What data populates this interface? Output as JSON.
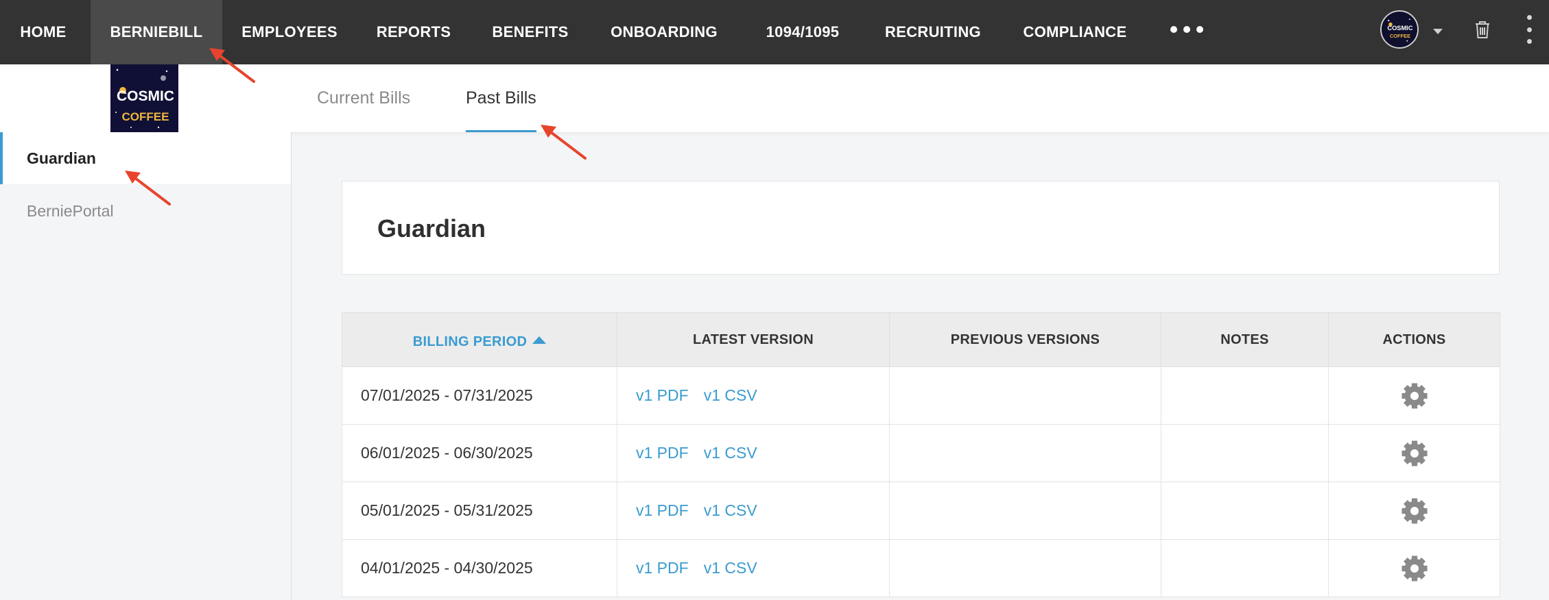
{
  "nav": {
    "items": [
      {
        "label": "HOME",
        "active": false
      },
      {
        "label": "BERNIEBILL",
        "active": true
      },
      {
        "label": "EMPLOYEES",
        "active": false
      },
      {
        "label": "REPORTS",
        "active": false
      },
      {
        "label": "BENEFITS",
        "active": false
      },
      {
        "label": "ONBOARDING",
        "active": false
      },
      {
        "label": "1094/1095",
        "active": false
      },
      {
        "label": "RECRUITING",
        "active": false
      },
      {
        "label": "COMPLIANCE",
        "active": false
      }
    ],
    "more_icon": "more-dots-icon",
    "avatar_text_line1": "COSMIC",
    "avatar_text_line2": "COFFEE",
    "caret_icon": "caret-down-icon",
    "trash_icon": "trash-icon",
    "kebab_icon": "kebab-menu-icon"
  },
  "logo": {
    "line1": "COSMIC",
    "line2": "COFFEE"
  },
  "tabs": [
    {
      "label": "Current Bills",
      "active": false
    },
    {
      "label": "Past Bills",
      "active": true
    }
  ],
  "sidebar": {
    "items": [
      {
        "label": "Guardian",
        "active": true
      },
      {
        "label": "BerniePortal",
        "active": false
      }
    ]
  },
  "main": {
    "carrier_title": "Guardian",
    "table": {
      "headers": [
        "BILLING PERIOD",
        "LATEST VERSION",
        "PREVIOUS VERSIONS",
        "NOTES",
        "ACTIONS"
      ],
      "sorted_column": "BILLING PERIOD",
      "sort_direction": "ascending",
      "rows": [
        {
          "period": "07/01/2025 - 07/31/2025",
          "pdf": "v1 PDF",
          "csv": "v1 CSV",
          "previous": "",
          "notes": "",
          "action_icon": "gear-icon"
        },
        {
          "period": "06/01/2025 - 06/30/2025",
          "pdf": "v1 PDF",
          "csv": "v1 CSV",
          "previous": "",
          "notes": "",
          "action_icon": "gear-icon"
        },
        {
          "period": "05/01/2025 - 05/31/2025",
          "pdf": "v1 PDF",
          "csv": "v1 CSV",
          "previous": "",
          "notes": "",
          "action_icon": "gear-icon"
        },
        {
          "period": "04/01/2025 - 04/30/2025",
          "pdf": "v1 PDF",
          "csv": "v1 CSV",
          "previous": "",
          "notes": "",
          "action_icon": "gear-icon"
        }
      ]
    }
  },
  "colors": {
    "nav_bg": "#333333",
    "nav_active_bg": "#4a4a4a",
    "accent": "#3a9bd0",
    "annotation_arrow": "#e8442d",
    "gear": "#8a8a8a"
  }
}
